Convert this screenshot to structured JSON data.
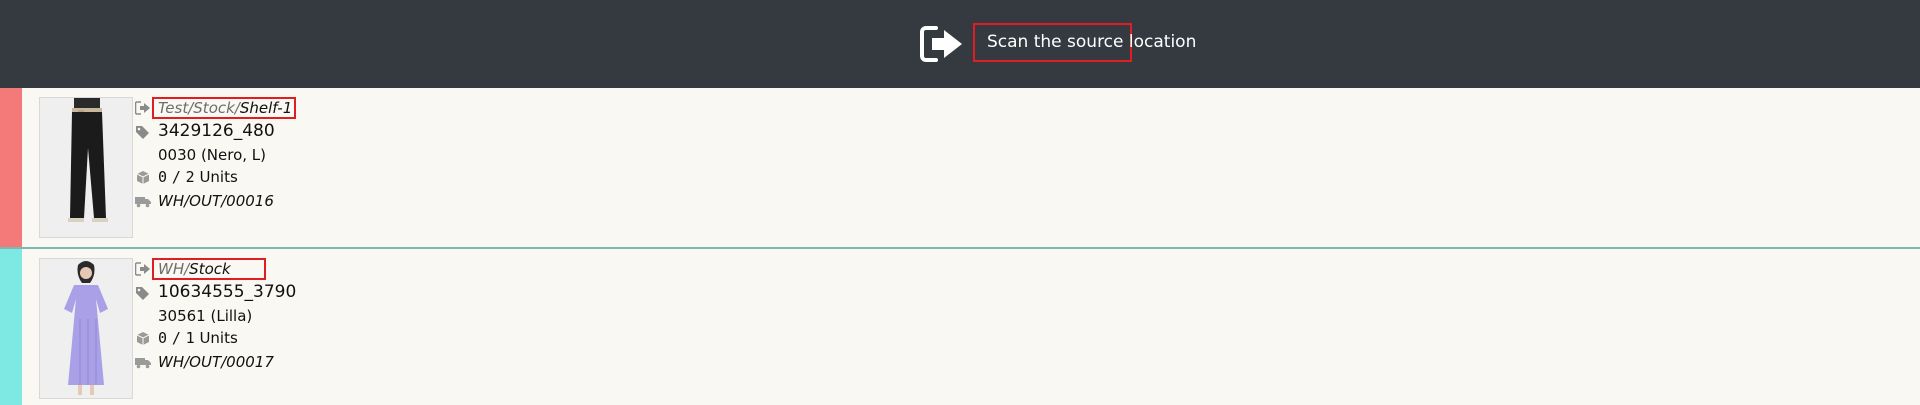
{
  "header": {
    "icon": "sign-in-arrow-icon",
    "prompt": "Scan the source location"
  },
  "colors": {
    "header_bg": "#343a40",
    "row1_stripe": "#f37a79",
    "row2_stripe": "#7ee8e2",
    "highlight_border": "#e11d24",
    "background": "#f9f8f2"
  },
  "lines": [
    {
      "location_prefix": "Test/Stock/",
      "location_last": "Shelf-1",
      "product": "3429126_480",
      "variant": "0030 (Nero, L)",
      "qty_done": "0",
      "qty_sep": "/",
      "qty_total": "2",
      "uom": "Units",
      "picking": "WH/OUT/00016",
      "image": "black-trousers-product-image"
    },
    {
      "location_prefix": "WH/",
      "location_last": "Stock",
      "product": "10634555_3790",
      "variant": "30561 (Lilla)",
      "qty_done": "0",
      "qty_sep": "/",
      "qty_total": "1",
      "uom": "Units",
      "picking": "WH/OUT/00017",
      "image": "lilac-dress-product-image"
    }
  ]
}
